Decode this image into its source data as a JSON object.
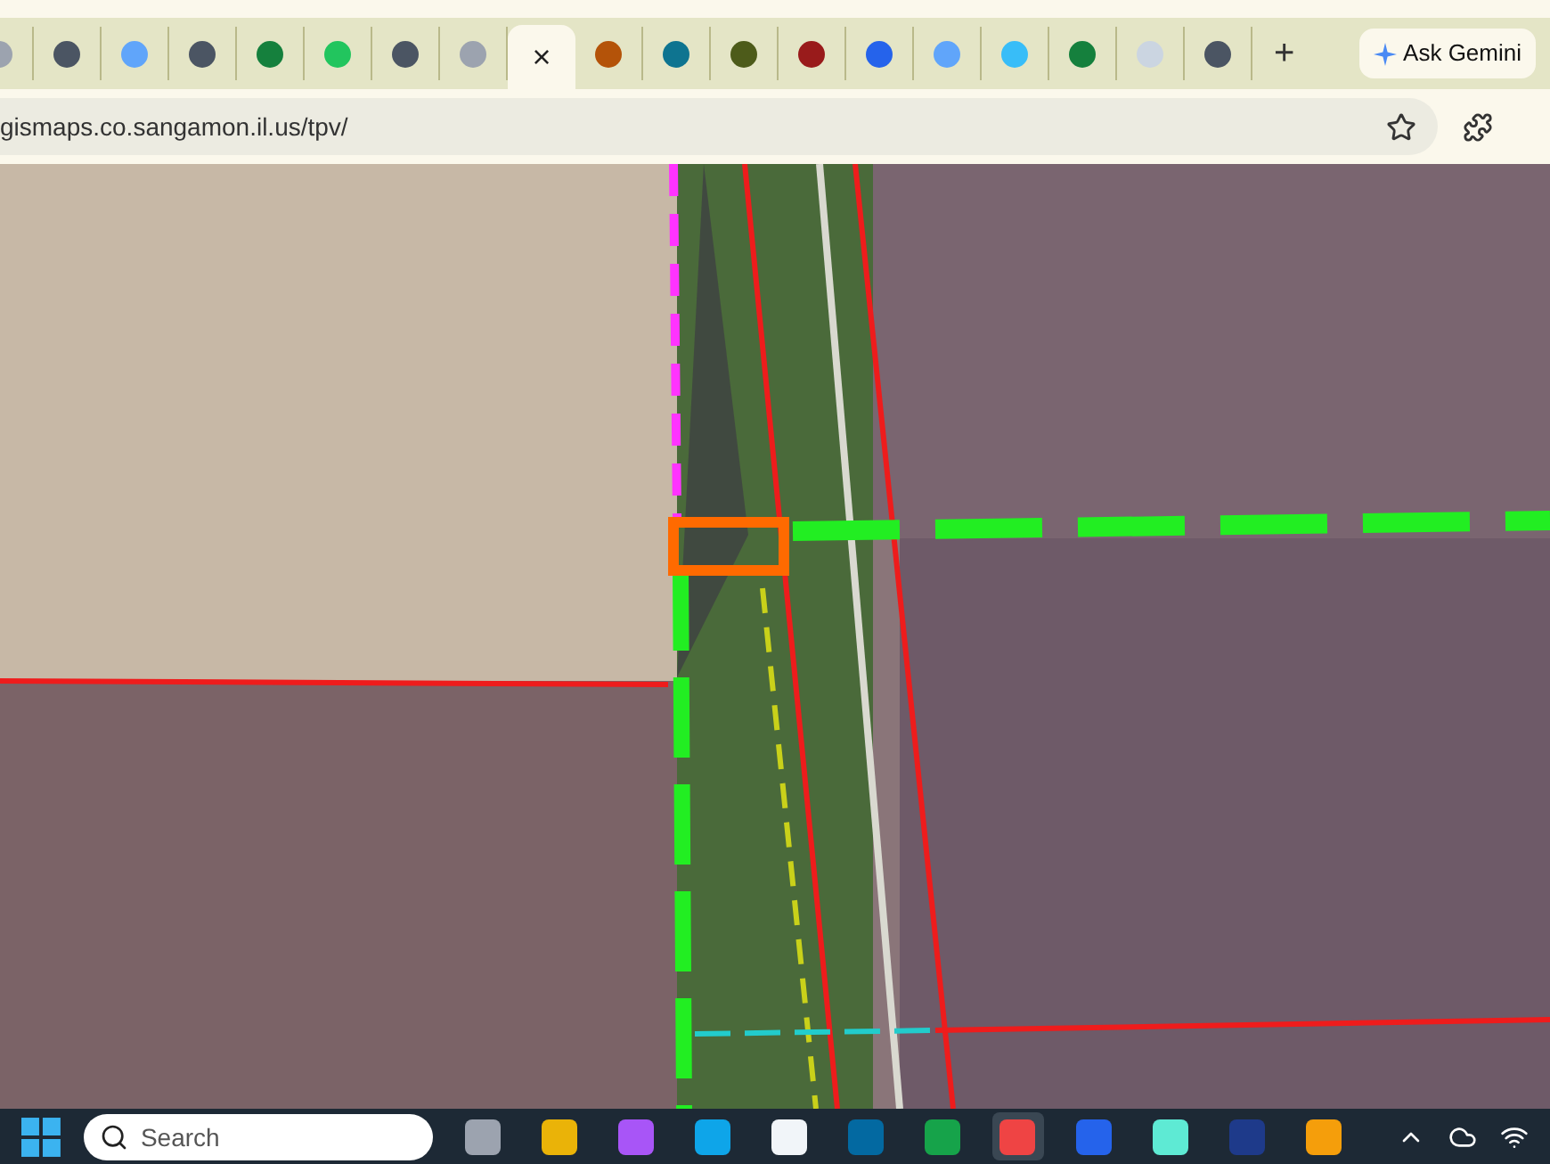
{
  "tabs": [
    {
      "selected": false,
      "color": "#9ca3af"
    },
    {
      "selected": false,
      "color": "#4b5563"
    },
    {
      "selected": false,
      "color": "#60a5fa"
    },
    {
      "selected": false,
      "color": "#4b5563"
    },
    {
      "selected": false,
      "color": "#15803d"
    },
    {
      "selected": false,
      "color": "#22c55e"
    },
    {
      "selected": false,
      "color": "#4b5563"
    },
    {
      "selected": false,
      "color": "#9ca3af"
    },
    {
      "selected": true,
      "close": "×"
    },
    {
      "selected": false,
      "color": "#b45309"
    },
    {
      "selected": false,
      "color": "#0e7490"
    },
    {
      "selected": false,
      "color": "#4d5b1a"
    },
    {
      "selected": false,
      "color": "#991b1b"
    },
    {
      "selected": false,
      "color": "#2563eb"
    },
    {
      "selected": false,
      "color": "#60a5fa"
    },
    {
      "selected": false,
      "color": "#38bdf8"
    },
    {
      "selected": false,
      "color": "#15803d"
    },
    {
      "selected": false,
      "color": "#cbd5e1"
    },
    {
      "selected": false,
      "color": "#4b5563"
    }
  ],
  "new_tab": "+",
  "gemini": "Ask Gemini",
  "address": "gismaps.co.sangamon.il.us/tpv/",
  "taskbar": {
    "search_placeholder": "Search",
    "apps": [
      {
        "selected": false,
        "color": "#9ca3af"
      },
      {
        "selected": false,
        "color": "#eab308"
      },
      {
        "selected": false,
        "color": "#a855f7"
      },
      {
        "selected": false,
        "color": "#0ea5e9"
      },
      {
        "selected": false,
        "color": "#f1f5f9"
      },
      {
        "selected": false,
        "color": "#0369a1"
      },
      {
        "selected": false,
        "color": "#16a34a"
      },
      {
        "selected": true,
        "color": "#ef4444"
      },
      {
        "selected": false,
        "color": "#2563eb"
      },
      {
        "selected": false,
        "color": "#5eead4"
      },
      {
        "selected": false,
        "color": "#1e3a8a"
      },
      {
        "selected": false,
        "color": "#f59e0b"
      }
    ]
  }
}
